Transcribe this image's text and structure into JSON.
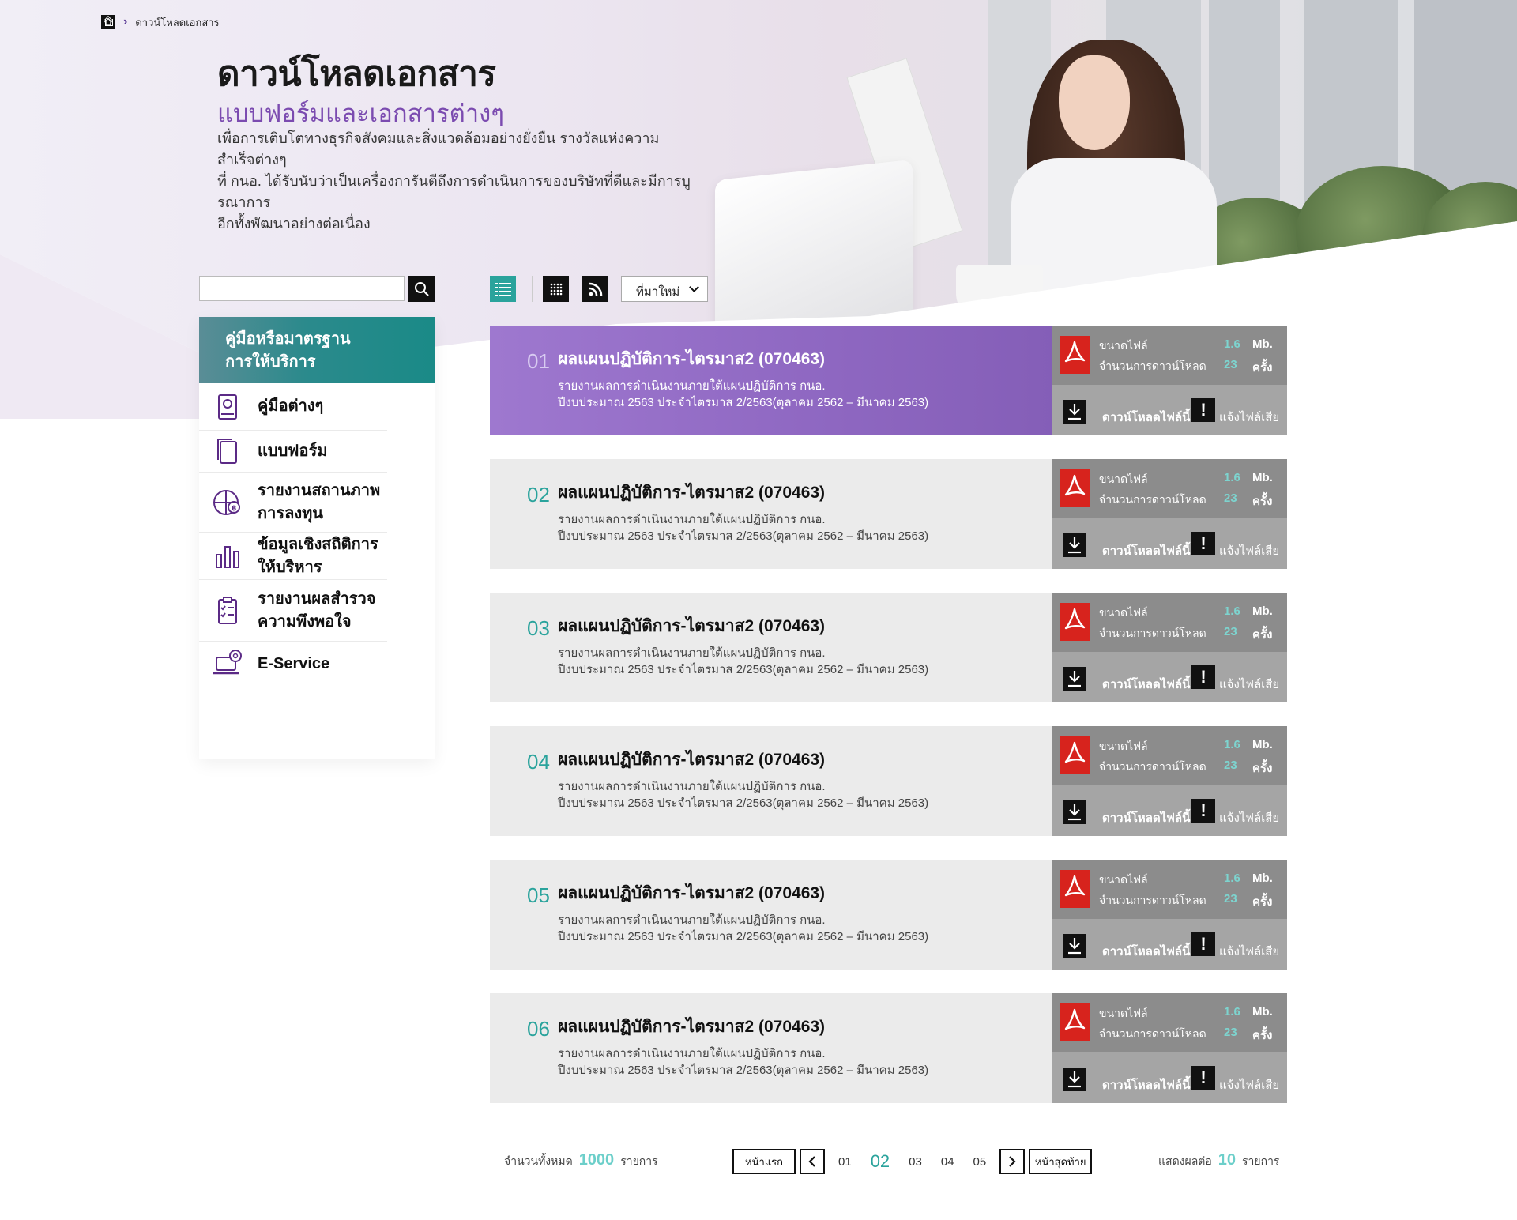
{
  "breadcrumb": {
    "current": "ดาวน์โหลดเอกสาร"
  },
  "hero": {
    "title": "ดาวน์โหลดเอกสาร",
    "subtitle": "แบบฟอร์มและเอกสารต่างๆ",
    "desc_lines": [
      "เพื่อการเติบโตทางธุรกิจสังคมและสิ่งแวดล้อมอย่างยั่งยืน รางวัลแห่งความสำเร็จต่างๆ",
      "ที่ กนอ. ได้รับนับว่าเป็นเครื่องการันตีถึงการดำเนินการของบริษัทที่ดีและมีการบูรณาการ",
      "อีกทั้งพัฒนาอย่างต่อเนื่อง"
    ]
  },
  "search": {
    "placeholder": ""
  },
  "sidebar": {
    "heading_lines": [
      "คู่มือหรือมาตรฐาน",
      "การให้บริการ"
    ],
    "items": [
      {
        "lines": [
          "คู่มือต่างๆ"
        ],
        "icon": "manual-book-icon"
      },
      {
        "lines": [
          "แบบฟอร์ม"
        ],
        "icon": "form-document-icon"
      },
      {
        "lines": [
          "รายงานสถานภาพ",
          "การลงทุน"
        ],
        "icon": "investment-pie-icon"
      },
      {
        "lines": [
          "ข้อมูลเชิงสถิติการให้บริหาร"
        ],
        "icon": "bar-chart-icon"
      },
      {
        "lines": [
          "รายงานผลสำรวจ",
          "ความพึงพอใจ"
        ],
        "icon": "checklist-icon"
      },
      {
        "lines": [
          "E-Service"
        ],
        "icon": "laptop-gear-icon"
      }
    ]
  },
  "toolbar": {
    "sort_value": "ที่มาใหม่",
    "view_icons": [
      "list-view-icon",
      "grid-view-icon",
      "rss-icon"
    ]
  },
  "documents": [
    {
      "num": "01",
      "title": "ผลแผนปฏิบัติการ-ไตรมาส2 (070463)",
      "line1": "รายงานผลการดำเนินงานภายใต้แผนปฏิบัติการ กนอ.",
      "line2": "ปีงบประมาณ 2563 ประจำไตรมาส 2/2563(ตุลาคม 2562 – มีนาคม 2563)",
      "size_label": "ขนาดไฟล์",
      "size_value": "1.6",
      "size_unit": "Mb.",
      "count_label": "จำนวนการดาวน์โหลด",
      "count_value": "23",
      "count_unit": "ครั้ง",
      "download_label": "ดาวน์โหลดไฟล์นี้",
      "report_label": "แจ้งไฟล์เสีย"
    },
    {
      "num": "02",
      "title": "ผลแผนปฏิบัติการ-ไตรมาส2 (070463)",
      "line1": "รายงานผลการดำเนินงานภายใต้แผนปฏิบัติการ กนอ.",
      "line2": "ปีงบประมาณ 2563 ประจำไตรมาส 2/2563(ตุลาคม 2562 – มีนาคม 2563)",
      "size_label": "ขนาดไฟล์",
      "size_value": "1.6",
      "size_unit": "Mb.",
      "count_label": "จำนวนการดาวน์โหลด",
      "count_value": "23",
      "count_unit": "ครั้ง",
      "download_label": "ดาวน์โหลดไฟล์นี้",
      "report_label": "แจ้งไฟล์เสีย"
    },
    {
      "num": "03",
      "title": "ผลแผนปฏิบัติการ-ไตรมาส2 (070463)",
      "line1": "รายงานผลการดำเนินงานภายใต้แผนปฏิบัติการ กนอ.",
      "line2": "ปีงบประมาณ 2563 ประจำไตรมาส 2/2563(ตุลาคม 2562 – มีนาคม 2563)",
      "size_label": "ขนาดไฟล์",
      "size_value": "1.6",
      "size_unit": "Mb.",
      "count_label": "จำนวนการดาวน์โหลด",
      "count_value": "23",
      "count_unit": "ครั้ง",
      "download_label": "ดาวน์โหลดไฟล์นี้",
      "report_label": "แจ้งไฟล์เสีย"
    },
    {
      "num": "04",
      "title": "ผลแผนปฏิบัติการ-ไตรมาส2 (070463)",
      "line1": "รายงานผลการดำเนินงานภายใต้แผนปฏิบัติการ กนอ.",
      "line2": "ปีงบประมาณ 2563 ประจำไตรมาส 2/2563(ตุลาคม 2562 – มีนาคม 2563)",
      "size_label": "ขนาดไฟล์",
      "size_value": "1.6",
      "size_unit": "Mb.",
      "count_label": "จำนวนการดาวน์โหลด",
      "count_value": "23",
      "count_unit": "ครั้ง",
      "download_label": "ดาวน์โหลดไฟล์นี้",
      "report_label": "แจ้งไฟล์เสีย"
    },
    {
      "num": "05",
      "title": "ผลแผนปฏิบัติการ-ไตรมาส2 (070463)",
      "line1": "รายงานผลการดำเนินงานภายใต้แผนปฏิบัติการ กนอ.",
      "line2": "ปีงบประมาณ 2563 ประจำไตรมาส 2/2563(ตุลาคม 2562 – มีนาคม 2563)",
      "size_label": "ขนาดไฟล์",
      "size_value": "1.6",
      "size_unit": "Mb.",
      "count_label": "จำนวนการดาวน์โหลด",
      "count_value": "23",
      "count_unit": "ครั้ง",
      "download_label": "ดาวน์โหลดไฟล์นี้",
      "report_label": "แจ้งไฟล์เสีย"
    },
    {
      "num": "06",
      "title": "ผลแผนปฏิบัติการ-ไตรมาส2 (070463)",
      "line1": "รายงานผลการดำเนินงานภายใต้แผนปฏิบัติการ กนอ.",
      "line2": "ปีงบประมาณ 2563 ประจำไตรมาส 2/2563(ตุลาคม 2562 – มีนาคม 2563)",
      "size_label": "ขนาดไฟล์",
      "size_value": "1.6",
      "size_unit": "Mb.",
      "count_label": "จำนวนการดาวน์โหลด",
      "count_value": "23",
      "count_unit": "ครั้ง",
      "download_label": "ดาวน์โหลดไฟล์นี้",
      "report_label": "แจ้งไฟล์เสีย"
    }
  ],
  "pagination": {
    "total_label": "จำนวนทั้งหมด",
    "total_value": "1000",
    "total_unit": "รายการ",
    "first_label": "หน้าแรก",
    "last_label": "หน้าสุดท้าย",
    "pages": [
      "01",
      "02",
      "03",
      "04",
      "05"
    ],
    "current_page": "02",
    "show_label": "แสดงผลต่อ",
    "show_value": "10",
    "show_unit": "รายการ"
  },
  "colors": {
    "accent_teal": "#2aa39c",
    "accent_purple": "#7b4bb0",
    "pdf_red": "#d7231d"
  }
}
